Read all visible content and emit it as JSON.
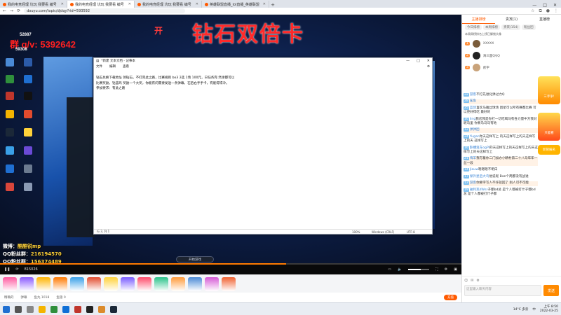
{
  "browser": {
    "tabs": [
      {
        "label": "我的电竞经理 坑玩 我要看 编号",
        "active": false
      },
      {
        "label": "我的电竞经理 坑玩 我要看 编号",
        "active": true
      },
      {
        "label": "我的电竞经理 坑玩 我要看 编号",
        "active": false
      },
      {
        "label": "英雄联盟直播_lol直播_英雄联盟",
        "active": false
      }
    ],
    "new_tab": "+",
    "window_controls": [
      "—",
      "□",
      "✕"
    ],
    "url": "douyu.com/topic/djdqy?rid=593592"
  },
  "stream": {
    "title_overlay": "钻石双倍卡",
    "qq_overlay": "群 q/v: 5392642",
    "small_top": "开",
    "id_lines": [
      "52887",
      "59308"
    ],
    "info_lines": [
      {
        "label": "微博：",
        "value": "酷酷锐mp"
      },
      {
        "label": "QQ粉丝群：",
        "value": "216194570"
      },
      {
        "label": "QQ粉丝群：",
        "value": "156374489"
      }
    ],
    "notepad": {
      "title": "*新建 文本文档 - 记事本",
      "menu": [
        "文件",
        "编辑",
        "查看"
      ],
      "body_lines": [
        "钻石兑换下载地址 领钻石，不打完此之路，比赛规则 bo3 2选 1场 100元，日任务完 然承都可以",
        "  比赛奖励，钻蓝鸡 奖励一个大奖，你能有问需要发送一条弹幕，石后右手手卡，有能得得冷。",
        "  参加要求：有此之路"
      ],
      "status": {
        "position": "行 3, 列 1",
        "zoom": "100%",
        "eol": "Windows (CRLF)",
        "encoding": "UTF-8"
      }
    },
    "start_button": "开始游戏",
    "controls": {
      "time": "815026",
      "progress": 0.62,
      "volume": 0.6
    }
  },
  "giftbar": {
    "count": 14
  },
  "below_bar": {
    "items": [
      "精确的",
      "弹幕",
      "鱼丸 1018",
      "鱼翅 0"
    ],
    "charge": "充值"
  },
  "sidebar": {
    "tabs": [
      {
        "label": "主播排榜",
        "active": true
      },
      {
        "label": "贵宾(1)",
        "active": false
      },
      {
        "label": "直播榜",
        "active": false
      }
    ],
    "subtabs": [
      "今日排榜",
      "本周排榜",
      "贵宾(154)",
      "粉丝团"
    ],
    "notice": "本周周榜排名上榜已解锁头像",
    "ranks": [
      {
        "name": "XXXXX",
        "badge": "1"
      },
      {
        "name": "海三面Q♀Q",
        "badge": "2"
      },
      {
        "name": "疾字",
        "badge": "3"
      }
    ],
    "chat": [
      {
        "lv": "22",
        "name": "游客",
        "text": "不打先进化弹过力Q"
      },
      {
        "lv": "28",
        "name": "鲨鱼",
        "text": ""
      },
      {
        "lv": "25",
        "name": "蓝鸽",
        "text": "喜欢马雅丝球场 团星可以所有赛都比赛 可以更好得吃 最好的"
      },
      {
        "lv": "16",
        "name": "ling",
        "text": "我这我是你打一切吃喝马有各力量中方我对呢马里 你要马马马有地"
      },
      {
        "lv": "12",
        "name": "弹弹团",
        "text": ""
      },
      {
        "lv": "24",
        "name": "Yugan",
        "text": "你天这样写上 的天这样写上的天这样写上的天 这样写上"
      },
      {
        "lv": "16",
        "name": "卧槽鬼车ogPl",
        "text": "的天这样写上的天这样写上的天这样写上的天这样写上"
      },
      {
        "lv": "21",
        "name": "嗨羊",
        "text": "我写着你二门加办小精村第二十八马年年一丝一段"
      },
      {
        "lv": "14",
        "name": "Jiauw",
        "text": "嗯嗯嗯不明白"
      },
      {
        "lv": "17",
        "name": "保外星后大鸟",
        "text": "他说呢 Ban个两都没有战进"
      },
      {
        "lv": "13",
        "name": "游客",
        "text": "你要字写人不许就回了 别人可不可能"
      },
      {
        "lv": "19",
        "name": "破利克dWsr",
        "text": "子都bd总 是个人都被打什子都bd总 是个人都被打什子都"
      }
    ],
    "ads": [
      "三手争!",
      "只能看",
      "新管报名"
    ],
    "input": {
      "tools": [
        "☺",
        "✉",
        "⚙"
      ],
      "placeholder": "这里输入聊天内容",
      "send": "发送"
    }
  },
  "taskbar": {
    "weather": "14°C 多云",
    "lang": "中",
    "time": "上午 8:50",
    "date": "2022-03-25"
  }
}
